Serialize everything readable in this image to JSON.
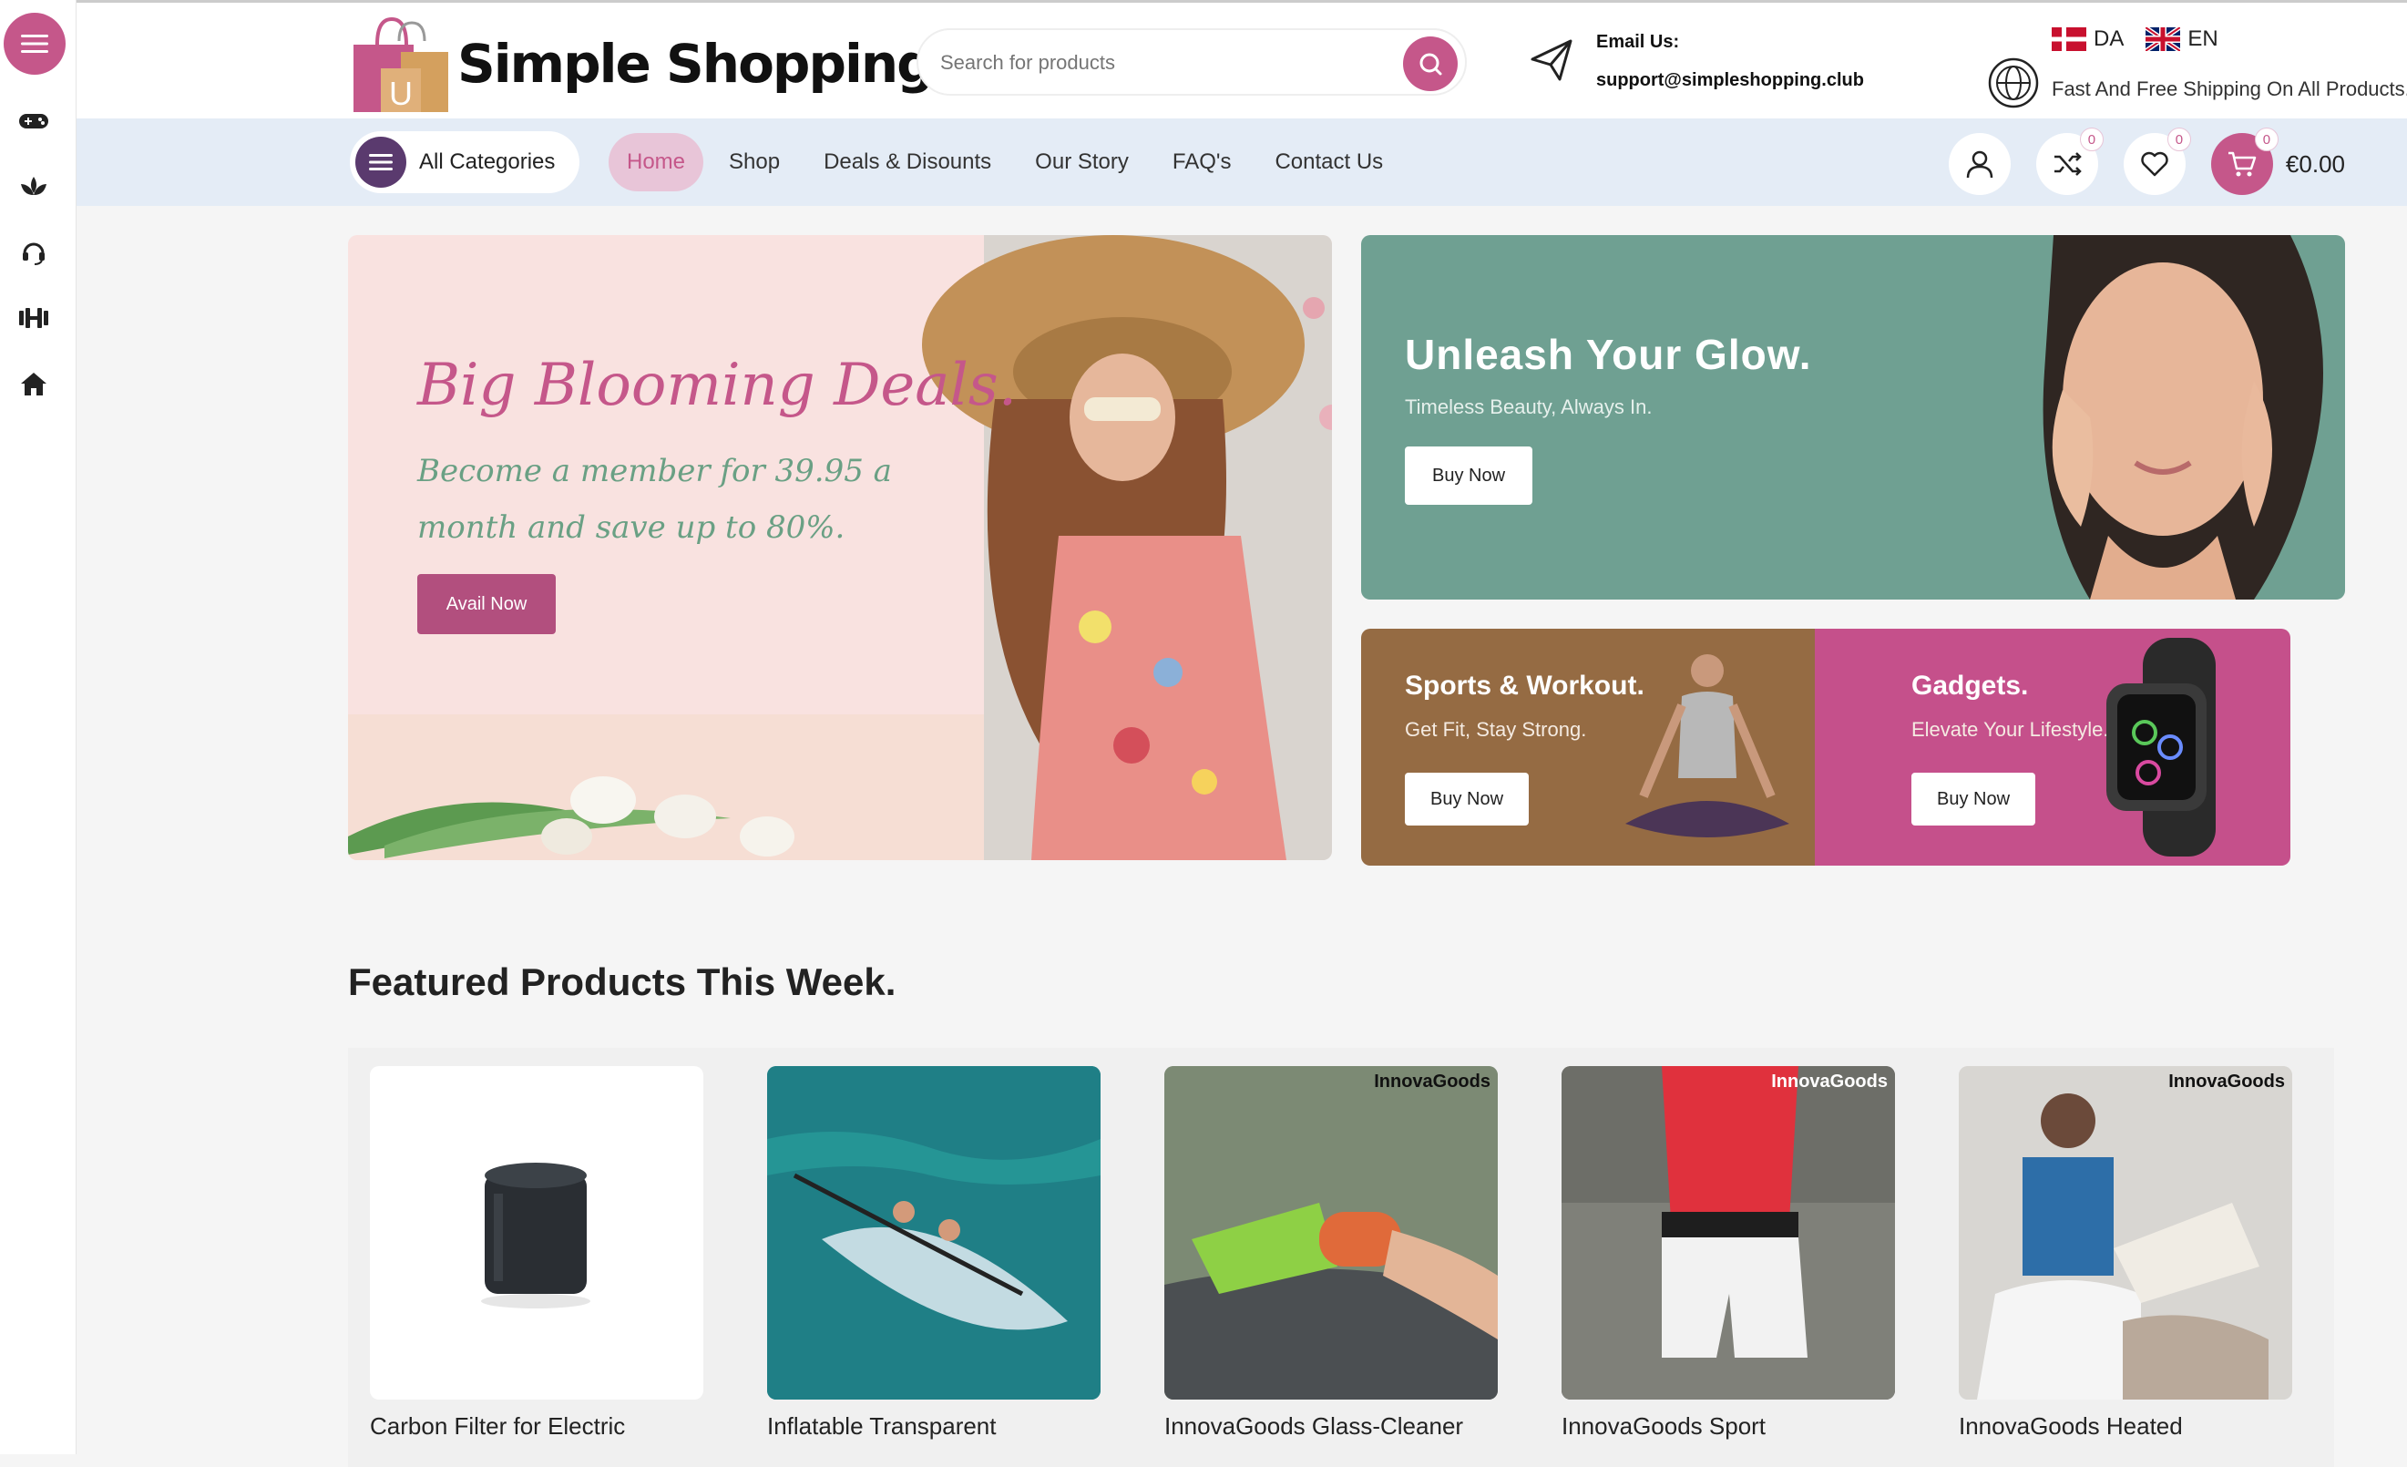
{
  "header": {
    "logo_letter": "U",
    "logo_text": "Simple Shopping",
    "search": {
      "placeholder": "Search for products"
    },
    "email_label": "Email Us:",
    "email_value": "support@simpleshopping.club",
    "languages": [
      {
        "code": "DA"
      },
      {
        "code": "EN"
      }
    ],
    "shipping_text": "Fast And Free Shipping On All Products."
  },
  "nav": {
    "all_categories": "All Categories",
    "links": [
      "Home",
      "Shop",
      "Deals & Disounts",
      "Our Story",
      "FAQ's",
      "Contact Us"
    ],
    "compare_count": "0",
    "wishlist_count": "0",
    "cart_count": "0",
    "cart_total": "€0.00"
  },
  "hero": {
    "title": "Big Blooming Deals.",
    "subtitle": "Become a member for 39.95 a month and save up to 80%.",
    "button": "Avail Now"
  },
  "promo_glow": {
    "title": "Unleash Your Glow.",
    "subtitle": "Timeless Beauty, Always In.",
    "button": "Buy Now"
  },
  "promo_sports": {
    "title": "Sports & Workout.",
    "subtitle": "Get Fit, Stay Strong.",
    "button": "Buy Now"
  },
  "promo_gadgets": {
    "title": "Gadgets.",
    "subtitle": "Elevate Your Lifestyle.",
    "button": "Buy Now"
  },
  "featured": {
    "title": "Featured Products This Week.",
    "products": [
      {
        "name": "Carbon Filter for Electric",
        "brand": ""
      },
      {
        "name": "Inflatable Transparent",
        "brand": ""
      },
      {
        "name": "InnovaGoods Glass-Cleaner",
        "brand": "InnovaGoods"
      },
      {
        "name": "InnovaGoods Sport",
        "brand": "InnovaGoods"
      },
      {
        "name": "InnovaGoods Heated",
        "brand": "InnovaGoods"
      }
    ]
  },
  "colors": {
    "accent": "#c5578a",
    "nav_bg": "#e4ecf6",
    "teal": "#6fa092",
    "brown": "#956b43"
  },
  "sidebar_icons": [
    "menu-icon",
    "gamepad-icon",
    "lotus-icon",
    "headset-icon",
    "dumbbell-icon",
    "home-icon"
  ]
}
